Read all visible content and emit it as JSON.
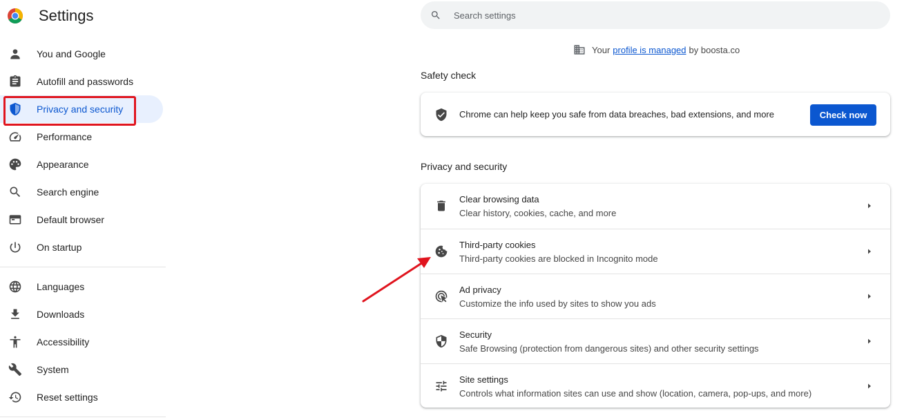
{
  "app": {
    "title": "Settings",
    "logo_icon": "chrome-logo-icon"
  },
  "sidebar": {
    "items": [
      {
        "label": "You and Google",
        "icon": "person-icon"
      },
      {
        "label": "Autofill and passwords",
        "icon": "clipboard-icon"
      },
      {
        "label": "Privacy and security",
        "icon": "shield-icon",
        "active": true
      },
      {
        "label": "Performance",
        "icon": "speedometer-icon"
      },
      {
        "label": "Appearance",
        "icon": "palette-icon"
      },
      {
        "label": "Search engine",
        "icon": "search-icon"
      },
      {
        "label": "Default browser",
        "icon": "browser-window-icon"
      },
      {
        "label": "On startup",
        "icon": "power-icon"
      },
      {
        "label": "Languages",
        "icon": "globe-icon"
      },
      {
        "label": "Downloads",
        "icon": "download-icon"
      },
      {
        "label": "Accessibility",
        "icon": "accessibility-icon"
      },
      {
        "label": "System",
        "icon": "wrench-icon"
      },
      {
        "label": "Reset settings",
        "icon": "history-icon"
      }
    ]
  },
  "search": {
    "placeholder": "Search settings",
    "value": ""
  },
  "managed": {
    "prefix": "Your",
    "link": "profile is managed",
    "suffix": "by boosta.co",
    "icon": "building-icon"
  },
  "safety_check": {
    "title": "Safety check",
    "text": "Chrome can help keep you safe from data breaches, bad extensions, and more",
    "button": "Check now",
    "icon": "shield-check-icon"
  },
  "privacy": {
    "title": "Privacy and security",
    "rows": [
      {
        "title": "Clear browsing data",
        "subtitle": "Clear history, cookies, cache, and more",
        "icon": "trash-icon"
      },
      {
        "title": "Third-party cookies",
        "subtitle": "Third-party cookies are blocked in Incognito mode",
        "icon": "cookie-icon"
      },
      {
        "title": "Ad privacy",
        "subtitle": "Customize the info used by sites to show you ads",
        "icon": "ad-privacy-icon"
      },
      {
        "title": "Security",
        "subtitle": "Safe Browsing (protection from dangerous sites) and other security settings",
        "icon": "shield-icon"
      },
      {
        "title": "Site settings",
        "subtitle": "Controls what information sites can use and show (location, camera, pop-ups, and more)",
        "icon": "sliders-icon"
      }
    ]
  },
  "colors": {
    "accent": "#0b57d0",
    "active_bg": "#e8f0fe",
    "annotation_red": "#e0141e"
  }
}
